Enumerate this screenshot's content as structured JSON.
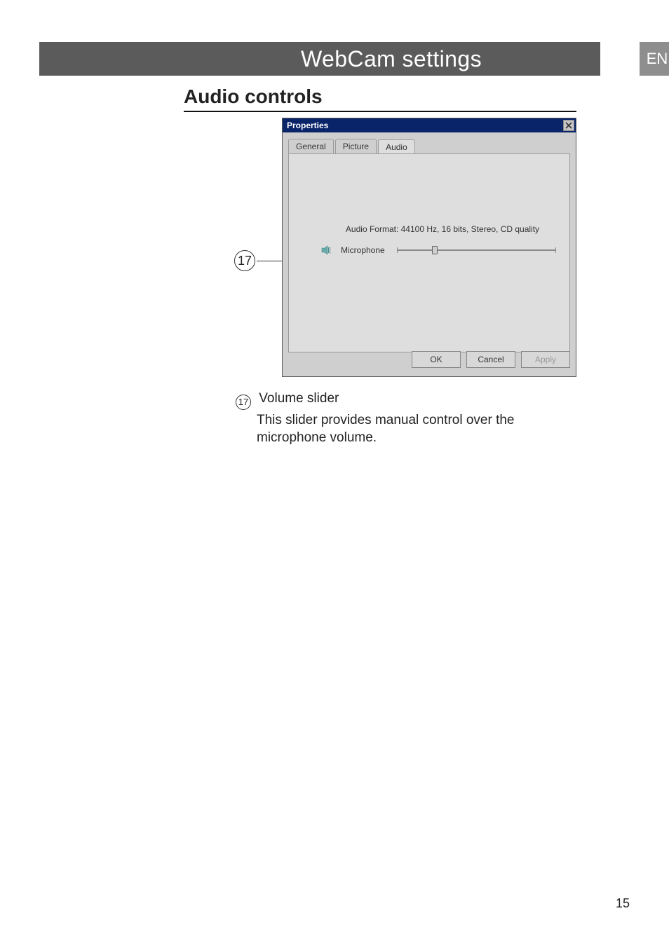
{
  "header": {
    "title": "WebCam settings",
    "lang": "EN"
  },
  "section": {
    "title": "Audio controls"
  },
  "callout": {
    "num": "17"
  },
  "dialog": {
    "title": "Properties",
    "tabs": {
      "general": "General",
      "picture": "Picture",
      "audio": "Audio"
    },
    "audio_format": "Audio Format: 44100 Hz, 16 bits, Stereo, CD quality",
    "mic_label": "Microphone",
    "buttons": {
      "ok": "OK",
      "cancel": "Cancel",
      "apply": "Apply"
    }
  },
  "desc": {
    "marker": "17",
    "heading": "Volume slider",
    "body": "This slider provides manual control over the microphone volume."
  },
  "page_number": "15"
}
